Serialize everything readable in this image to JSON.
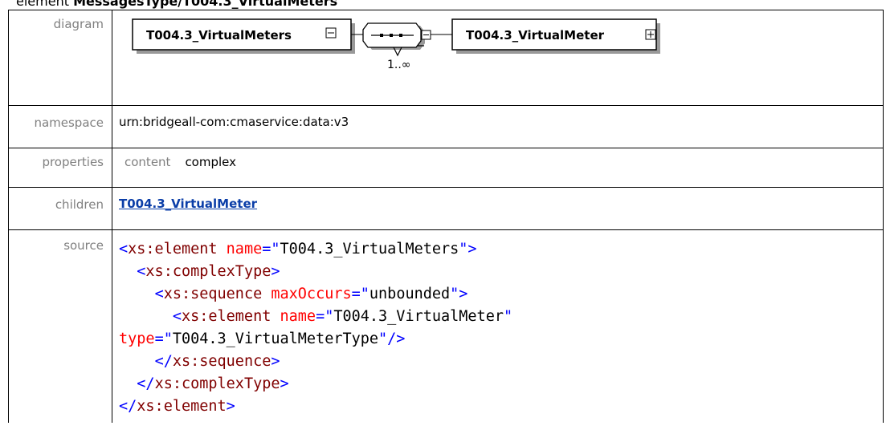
{
  "heading": {
    "prefix": "element",
    "path": "MessagesType/T004.3_VirtualMeters"
  },
  "labels": {
    "diagram": "diagram",
    "namespace": "namespace",
    "properties": "properties",
    "children": "children",
    "source": "source"
  },
  "diagram": {
    "element_name": "T004.3_VirtualMeters",
    "occurrence": "1..∞",
    "child_name": "T004.3_VirtualMeter"
  },
  "namespace": "urn:bridgeall-com:cmaservice:data:v3",
  "properties": {
    "key": "content",
    "value": "complex"
  },
  "children": {
    "link": "T004.3_VirtualMeter"
  },
  "source": {
    "lines": [
      [
        [
          "br",
          "<"
        ],
        [
          "t",
          "xs:element"
        ],
        [
          "sp",
          " "
        ],
        [
          "an",
          "name"
        ],
        [
          "br",
          "=\""
        ],
        [
          "av",
          "T004.3_VirtualMeters"
        ],
        [
          "br",
          "\">"
        ]
      ],
      [
        [
          "sp",
          "  "
        ],
        [
          "br",
          "<"
        ],
        [
          "t",
          "xs:complexType"
        ],
        [
          "br",
          ">"
        ]
      ],
      [
        [
          "sp",
          "    "
        ],
        [
          "br",
          "<"
        ],
        [
          "t",
          "xs:sequence"
        ],
        [
          "sp",
          " "
        ],
        [
          "an",
          "maxOccurs"
        ],
        [
          "br",
          "=\""
        ],
        [
          "av",
          "unbounded"
        ],
        [
          "br",
          "\">"
        ]
      ],
      [
        [
          "sp",
          "      "
        ],
        [
          "br",
          "<"
        ],
        [
          "t",
          "xs:element"
        ],
        [
          "sp",
          " "
        ],
        [
          "an",
          "name"
        ],
        [
          "br",
          "=\""
        ],
        [
          "av",
          "T004.3_VirtualMeter"
        ],
        [
          "br",
          "\""
        ]
      ],
      [
        [
          "an",
          "type"
        ],
        [
          "br",
          "=\""
        ],
        [
          "av",
          "T004.3_VirtualMeterType"
        ],
        [
          "br",
          "\"/>"
        ]
      ],
      [
        [
          "sp",
          "    "
        ],
        [
          "br",
          "</"
        ],
        [
          "t",
          "xs:sequence"
        ],
        [
          "br",
          ">"
        ]
      ],
      [
        [
          "sp",
          "  "
        ],
        [
          "br",
          "</"
        ],
        [
          "t",
          "xs:complexType"
        ],
        [
          "br",
          ">"
        ]
      ],
      [
        [
          "br",
          "</"
        ],
        [
          "t",
          "xs:element"
        ],
        [
          "br",
          ">"
        ]
      ]
    ]
  }
}
